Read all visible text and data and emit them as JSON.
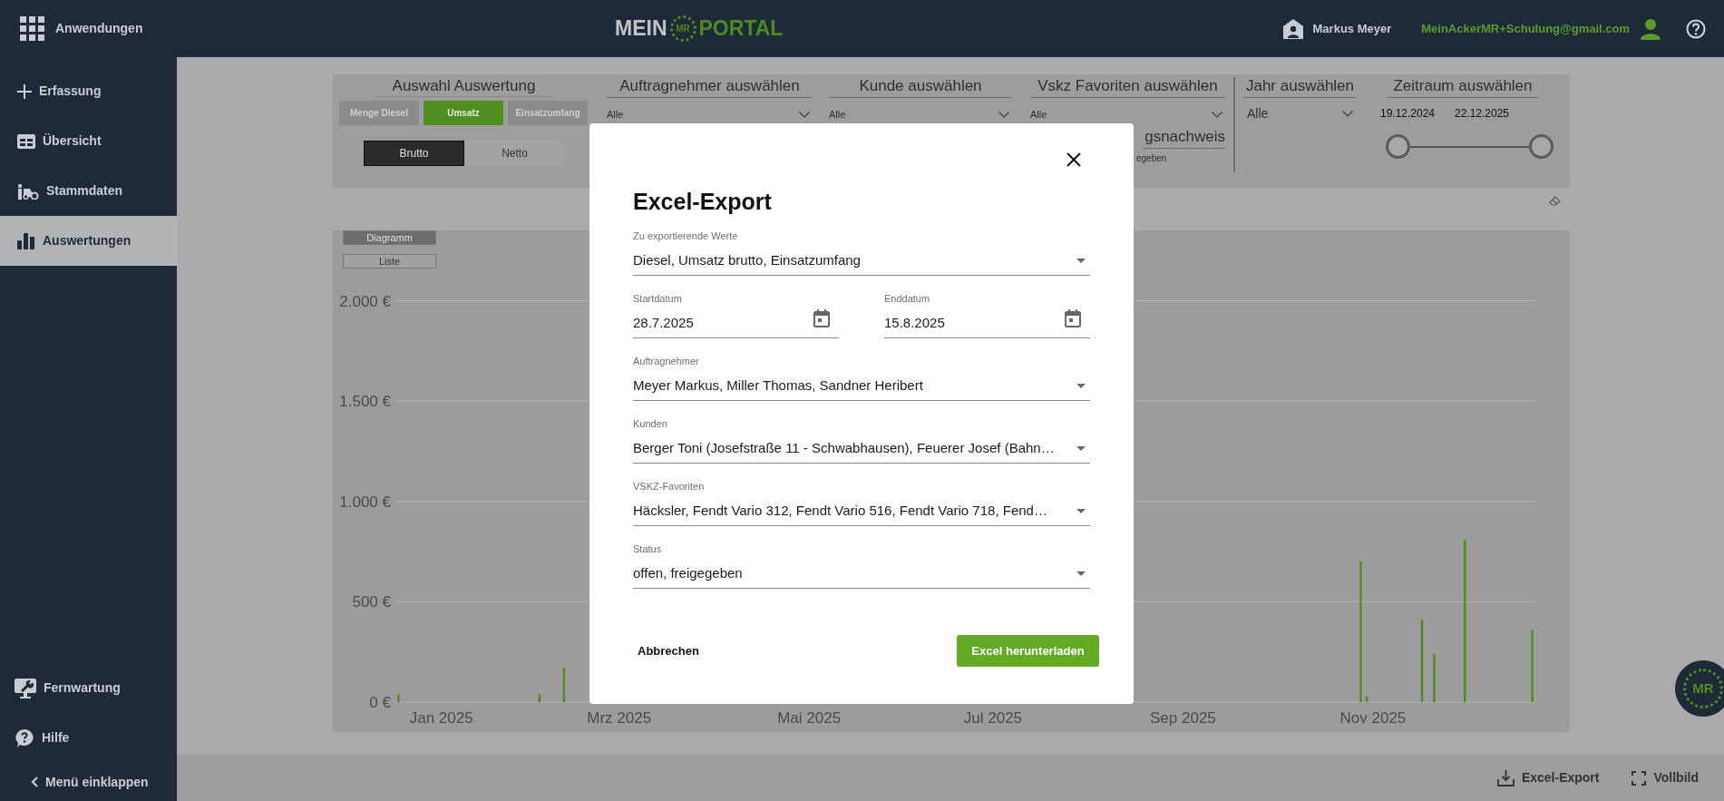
{
  "header": {
    "apps_label": "Anwendungen",
    "logo": {
      "left": "MEIN",
      "badge": "MR",
      "right": "PORTAL"
    },
    "user_name": "Markus Meyer",
    "email": "MeinAckerMR+Schulung@gmail.com"
  },
  "sidebar": {
    "items": [
      {
        "label": "Erfassung",
        "selected": false
      },
      {
        "label": "Übersicht",
        "selected": false
      },
      {
        "label": "Stammdaten",
        "selected": false
      },
      {
        "label": "Auswertungen",
        "selected": true
      }
    ],
    "bottom_items": [
      {
        "label": "Fernwartung"
      },
      {
        "label": "Hilfe"
      }
    ],
    "collapse_label": "Menü einklappen"
  },
  "filters": {
    "evaluation": {
      "heading": "Auswahl Auswertung",
      "options": [
        {
          "label": "Menge Diesel",
          "selected": false
        },
        {
          "label": "Umsatz",
          "selected": true
        },
        {
          "label": "Einsatzumfang",
          "selected": false
        }
      ],
      "modes": [
        {
          "label": "Brutto",
          "selected": true
        },
        {
          "label": "Netto",
          "selected": false
        }
      ]
    },
    "dropdowns": [
      {
        "heading": "Auftragnehmer auswählen",
        "value": "Alle"
      },
      {
        "heading": "Kunde auswählen",
        "value": "Alle"
      },
      {
        "heading": "Vskz Favoriten auswählen",
        "value": "Alle"
      }
    ],
    "partial": {
      "heading": "gsnachweis",
      "value": "egeben"
    },
    "year": {
      "heading": "Jahr auswählen",
      "value": "Alle"
    },
    "period": {
      "heading": "Zeitraum auswählen",
      "start": "19.12.2024",
      "end": "22.12.2025",
      "slider": {
        "level": 1
      }
    }
  },
  "chart": {
    "views": [
      {
        "label": "Diagramm",
        "selected": true
      },
      {
        "label": "Liste",
        "selected": false
      }
    ],
    "chart_data": {
      "type": "bar",
      "grid": true,
      "categories": [
        null,
        null,
        null,
        null,
        null,
        null,
        null,
        "Jan 2025",
        null,
        null,
        null,
        null,
        null,
        null,
        null,
        null,
        null,
        null,
        null,
        null,
        null,
        null,
        null,
        null,
        null,
        null,
        null,
        null,
        null,
        null,
        null,
        null,
        null,
        null,
        null,
        null,
        "Mrz 2025",
        null,
        null,
        null,
        null,
        null,
        null,
        null,
        null,
        null,
        null,
        null,
        null,
        null,
        null,
        null,
        null,
        null,
        null,
        null,
        null,
        null,
        null,
        null,
        null,
        null,
        null,
        null,
        null,
        null,
        null,
        "Mai 2025",
        null,
        null,
        null,
        null,
        null,
        null,
        null,
        null,
        null,
        null,
        null,
        null,
        null,
        null,
        null,
        null,
        null,
        null,
        null,
        null,
        null,
        null,
        null,
        null,
        null,
        null,
        null,
        null,
        null,
        "Jul 2025",
        null,
        null,
        null,
        null,
        null,
        null,
        null,
        null,
        null,
        null,
        null,
        null,
        null,
        null,
        null,
        null,
        null,
        null,
        null,
        null,
        null,
        null,
        null,
        null,
        null,
        null,
        null,
        null,
        null,
        null,
        "Sep 2025",
        null,
        null,
        null,
        null,
        null,
        null,
        null,
        null,
        null,
        null,
        null,
        null,
        null,
        null,
        null,
        null,
        null,
        null,
        null,
        null,
        null,
        null,
        null,
        null,
        null,
        null,
        null,
        null,
        null,
        null,
        "Nov 2025",
        null,
        null,
        null,
        null,
        null,
        null,
        null,
        null,
        null,
        null,
        null,
        null,
        null,
        null,
        null,
        null,
        null,
        null,
        null,
        null,
        null,
        null,
        null,
        null,
        null,
        null
      ],
      "series": [
        {
          "color": "#4f8f1f",
          "values": [
            40,
            null,
            null,
            null,
            null,
            null,
            null,
            null,
            null,
            null,
            null,
            null,
            null,
            null,
            null,
            null,
            null,
            null,
            null,
            null,
            null,
            null,
            null,
            40,
            null,
            null,
            null,
            170,
            null,
            null,
            null,
            null,
            null,
            null,
            null,
            null,
            null,
            null,
            null,
            null,
            null,
            null,
            null,
            null,
            null,
            null,
            null,
            null,
            null,
            null,
            null,
            null,
            null,
            null,
            null,
            null,
            null,
            null,
            null,
            null,
            null,
            null,
            null,
            null,
            null,
            null,
            null,
            null,
            null,
            null,
            null,
            null,
            null,
            null,
            null,
            null,
            null,
            null,
            null,
            null,
            null,
            null,
            null,
            null,
            null,
            null,
            null,
            null,
            null,
            null,
            null,
            null,
            null,
            null,
            null,
            null,
            null,
            null,
            null,
            null,
            null,
            null,
            null,
            null,
            null,
            null,
            null,
            null,
            null,
            null,
            null,
            null,
            null,
            null,
            null,
            null,
            null,
            null,
            null,
            null,
            null,
            null,
            null,
            null,
            null,
            null,
            null,
            null,
            null,
            null,
            null,
            null,
            null,
            null,
            null,
            null,
            null,
            null,
            null,
            null,
            null,
            null,
            null,
            null,
            null,
            null,
            null,
            null,
            null,
            null,
            null,
            null,
            null,
            null,
            null,
            null,
            null,
            700,
            30,
            null,
            null,
            null,
            null,
            null,
            null,
            null,
            null,
            410,
            null,
            240,
            null,
            null,
            null,
            null,
            810,
            null,
            null,
            null,
            null,
            null,
            null,
            null,
            null,
            null,
            null,
            360
          ]
        }
      ],
      "ylim": [
        0,
        2000
      ],
      "yticks": [
        {
          "value": 0,
          "label": "0 €"
        },
        {
          "value": 500,
          "label": "500 €"
        },
        {
          "value": 1000,
          "label": "1.000 €"
        },
        {
          "value": 1500,
          "label": "1.500 €"
        },
        {
          "value": 2000,
          "label": "2.000 €"
        }
      ]
    }
  },
  "modal": {
    "title": "Excel-Export",
    "fields": [
      {
        "kind": "select",
        "label": "Zu exportierende Werte",
        "value": "Diesel, Umsatz brutto, Einsatzumfang"
      },
      {
        "kind": "date",
        "label": "Startdatum",
        "value": "28.7.2025"
      },
      {
        "kind": "date",
        "label": "Enddatum",
        "value": "15.8.2025"
      },
      {
        "kind": "select",
        "label": "Auftragnehmer",
        "value": "Meyer Markus, Miller Thomas, Sandner Heribert"
      },
      {
        "kind": "select",
        "label": "Kunden",
        "value": "Berger Toni (Josefstraße 11 - Schwabhausen), Feuerer Josef (Bahn…"
      },
      {
        "kind": "select",
        "label": "VSKZ-Favoriten",
        "value": "Häcksler, Fendt Vario 312, Fendt Vario 516, Fendt Vario 718, Fend…"
      },
      {
        "kind": "select",
        "label": "Status",
        "value": "offen, freigegeben"
      }
    ],
    "cancel": "Abbrechen",
    "confirm": "Excel herunterladen"
  },
  "footer": {
    "actions": [
      {
        "label": "Excel-Export"
      },
      {
        "label": "Vollbild"
      }
    ]
  },
  "corner_badge": {
    "text": "MR"
  }
}
